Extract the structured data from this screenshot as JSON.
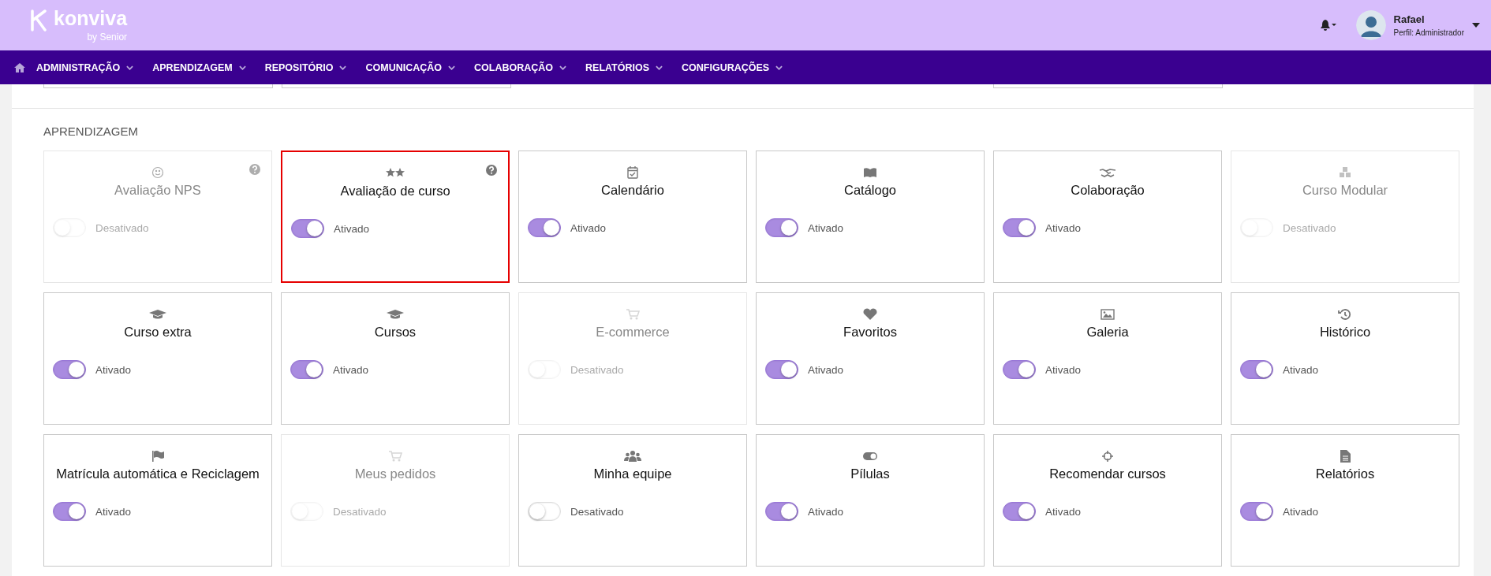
{
  "header": {
    "logo_text": "konviva",
    "logo_sub": "by Senior",
    "user": {
      "name": "Rafael",
      "profile": "Perfil: Administrador"
    }
  },
  "nav": [
    {
      "label": "ADMINISTRAÇÃO"
    },
    {
      "label": "APRENDIZAGEM"
    },
    {
      "label": "REPOSITÓRIO"
    },
    {
      "label": "COMUNICAÇÃO"
    },
    {
      "label": "COLABORAÇÃO"
    },
    {
      "label": "RELATÓRIOS"
    },
    {
      "label": "CONFIGURAÇÕES"
    }
  ],
  "section": {
    "title": "APRENDIZAGEM"
  },
  "cards": [
    {
      "title": "Avaliação NPS",
      "disabled": true,
      "on": false,
      "status": "Desativado",
      "help": true,
      "highlighted": false
    },
    {
      "title": "Avaliação de curso",
      "disabled": false,
      "on": true,
      "status": "Ativado",
      "help": true,
      "highlighted": true
    },
    {
      "title": "Calendário",
      "disabled": false,
      "on": true,
      "status": "Ativado",
      "help": false,
      "highlighted": false
    },
    {
      "title": "Catálogo",
      "disabled": false,
      "on": true,
      "status": "Ativado",
      "help": false,
      "highlighted": false
    },
    {
      "title": "Colaboração",
      "disabled": false,
      "on": true,
      "status": "Ativado",
      "help": false,
      "highlighted": false
    },
    {
      "title": "Curso Modular",
      "disabled": true,
      "on": false,
      "status": "Desativado",
      "help": false,
      "highlighted": false
    },
    {
      "title": "Curso extra",
      "disabled": false,
      "on": true,
      "status": "Ativado",
      "help": false,
      "highlighted": false
    },
    {
      "title": "Cursos",
      "disabled": false,
      "on": true,
      "status": "Ativado",
      "help": false,
      "highlighted": false
    },
    {
      "title": "E-commerce",
      "disabled": true,
      "on": false,
      "status": "Desativado",
      "help": false,
      "highlighted": false
    },
    {
      "title": "Favoritos",
      "disabled": false,
      "on": true,
      "status": "Ativado",
      "help": false,
      "highlighted": false
    },
    {
      "title": "Galeria",
      "disabled": false,
      "on": true,
      "status": "Ativado",
      "help": false,
      "highlighted": false
    },
    {
      "title": "Histórico",
      "disabled": false,
      "on": true,
      "status": "Ativado",
      "help": false,
      "highlighted": false
    },
    {
      "title": "Matrícula automática e Reciclagem",
      "disabled": false,
      "on": true,
      "status": "Ativado",
      "help": false,
      "highlighted": false
    },
    {
      "title": "Meus pedidos",
      "disabled": true,
      "on": false,
      "status": "Desativado",
      "help": false,
      "highlighted": false
    },
    {
      "title": "Minha equipe",
      "disabled": false,
      "on": false,
      "status": "Desativado",
      "help": false,
      "highlighted": false
    },
    {
      "title": "Pílulas",
      "disabled": false,
      "on": true,
      "status": "Ativado",
      "help": false,
      "highlighted": false
    },
    {
      "title": "Recomendar cursos",
      "disabled": false,
      "on": true,
      "status": "Ativado",
      "help": false,
      "highlighted": false
    },
    {
      "title": "Relatórios",
      "disabled": false,
      "on": true,
      "status": "Ativado",
      "help": false,
      "highlighted": false
    }
  ]
}
